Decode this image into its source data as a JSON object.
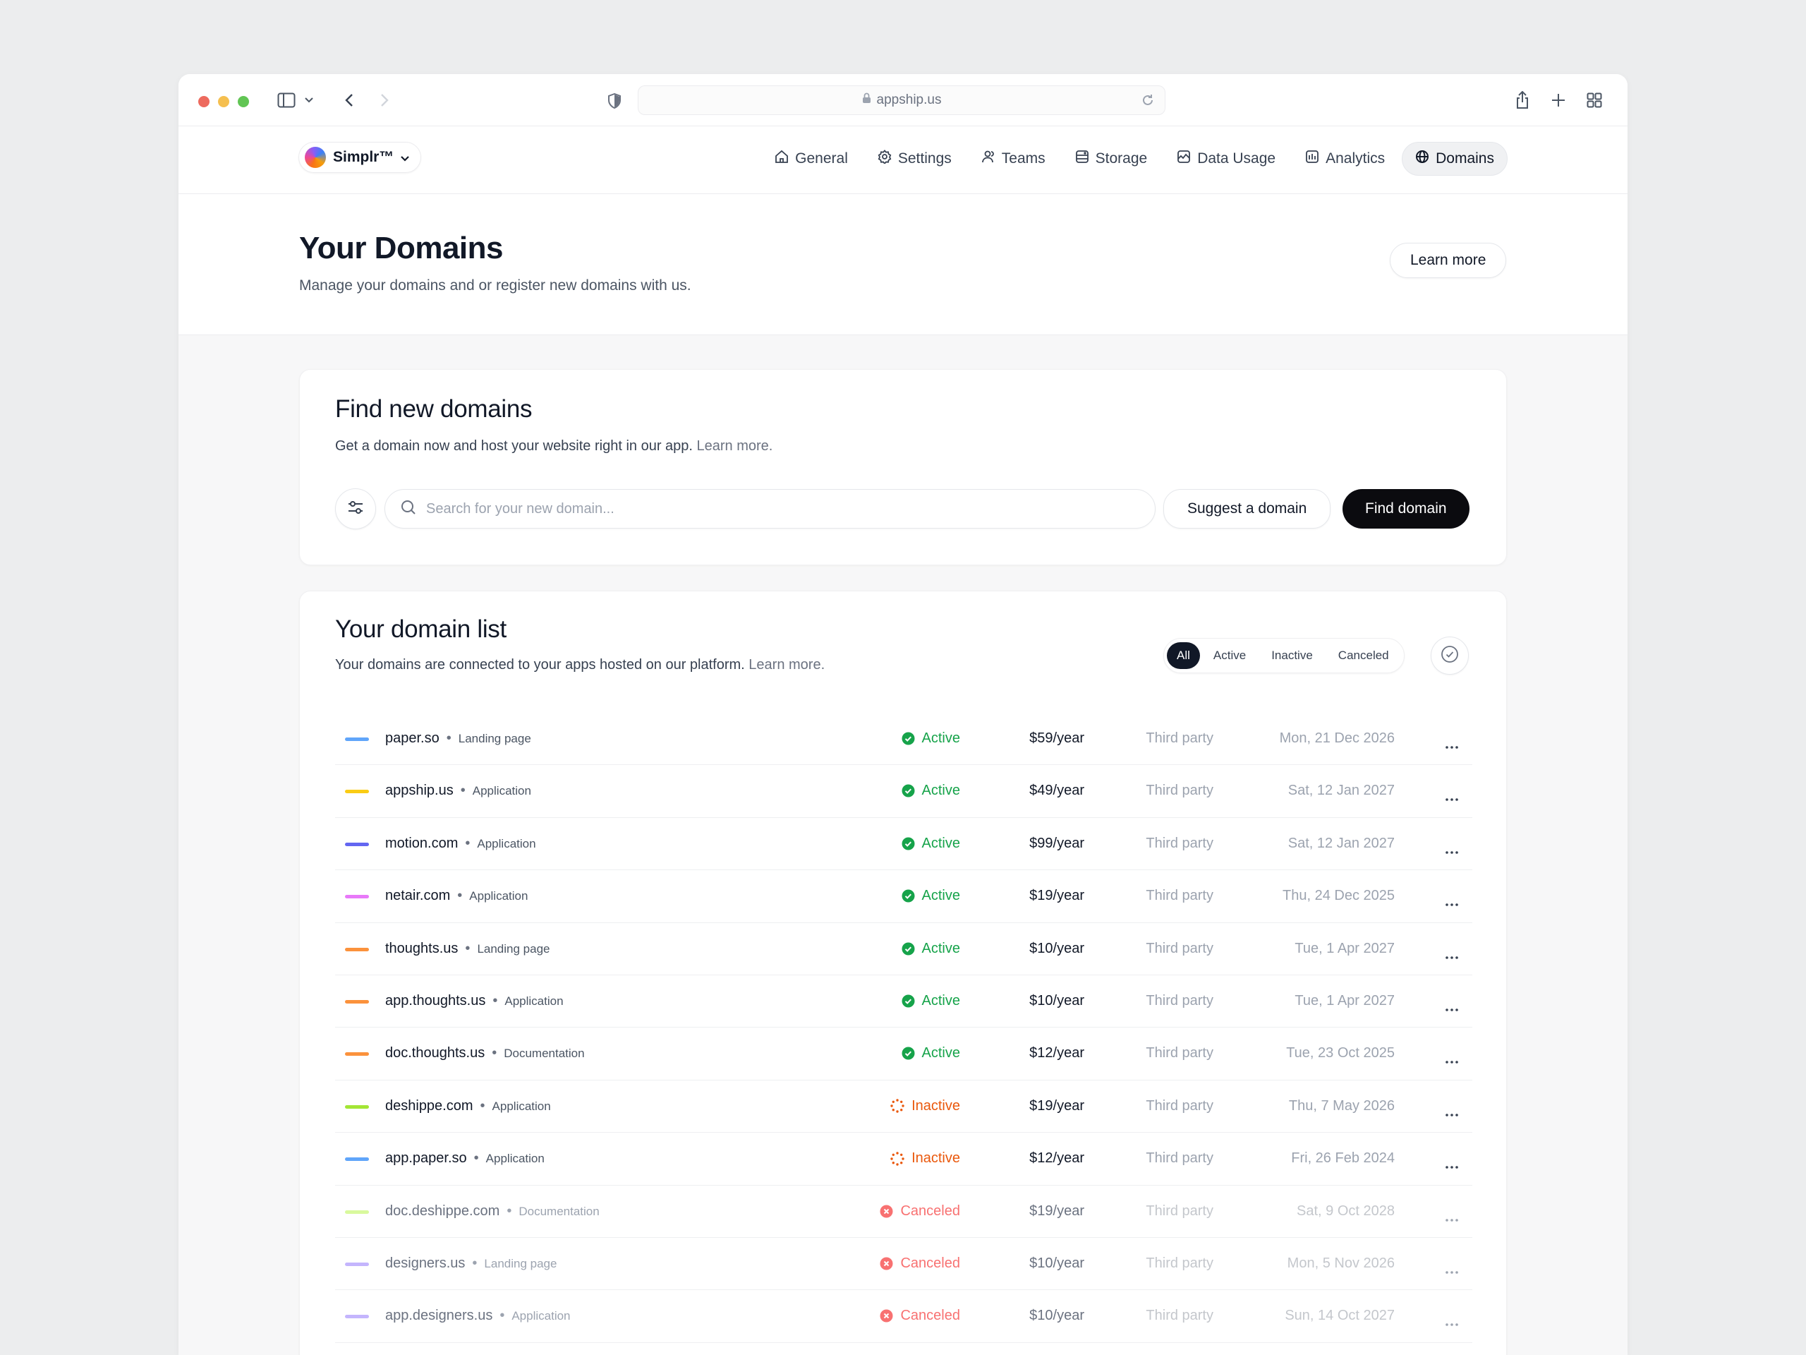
{
  "browser": {
    "url": "appship.us",
    "traffic_lights": [
      "#ed6a5e",
      "#f5bf4f",
      "#61c554"
    ]
  },
  "app": {
    "brand_name": "Simplr™",
    "nav": [
      {
        "label": "General",
        "icon": "home-icon",
        "active": false
      },
      {
        "label": "Settings",
        "icon": "gear-icon",
        "active": false
      },
      {
        "label": "Teams",
        "icon": "users-icon",
        "active": false
      },
      {
        "label": "Storage",
        "icon": "database-icon",
        "active": false
      },
      {
        "label": "Data Usage",
        "icon": "chart-box-icon",
        "active": false
      },
      {
        "label": "Analytics",
        "icon": "bars-icon",
        "active": false
      },
      {
        "label": "Domains",
        "icon": "globe-icon",
        "active": true
      }
    ]
  },
  "hero": {
    "title": "Your Domains",
    "subtitle": "Manage your domains and or register new domains with us.",
    "learn_more": "Learn more"
  },
  "find": {
    "title": "Find new domains",
    "subtitle": "Get a domain now and host your website right in our app.",
    "subtitle_link": "Learn more.",
    "search_placeholder": "Search for your new domain...",
    "suggest_label": "Suggest a domain",
    "find_label": "Find domain"
  },
  "list": {
    "title": "Your domain list",
    "subtitle": "Your domains are connected to your apps hosted on our platform.",
    "subtitle_link": "Learn more.",
    "filters": [
      "All",
      "Active",
      "Inactive",
      "Canceled"
    ],
    "selected_filter": "All",
    "domains": [
      {
        "name": "paper.so",
        "type": "Landing page",
        "status": "Active",
        "price": "$59/year",
        "provider": "Third party",
        "date": "Mon, 21 Dec 2026",
        "color": "#60a5fa"
      },
      {
        "name": "appship.us",
        "type": "Application",
        "status": "Active",
        "price": "$49/year",
        "provider": "Third party",
        "date": "Sat, 12 Jan 2027",
        "color": "#facc15"
      },
      {
        "name": "motion.com",
        "type": "Application",
        "status": "Active",
        "price": "$99/year",
        "provider": "Third party",
        "date": "Sat, 12 Jan 2027",
        "color": "#6366f1"
      },
      {
        "name": "netair.com",
        "type": "Application",
        "status": "Active",
        "price": "$19/year",
        "provider": "Third party",
        "date": "Thu, 24 Dec 2025",
        "color": "#e879f9"
      },
      {
        "name": "thoughts.us",
        "type": "Landing page",
        "status": "Active",
        "price": "$10/year",
        "provider": "Third party",
        "date": "Tue, 1 Apr 2027",
        "color": "#fb923c"
      },
      {
        "name": "app.thoughts.us",
        "type": "Application",
        "status": "Active",
        "price": "$10/year",
        "provider": "Third party",
        "date": "Tue, 1 Apr 2027",
        "color": "#fb923c"
      },
      {
        "name": "doc.thoughts.us",
        "type": "Documentation",
        "status": "Active",
        "price": "$12/year",
        "provider": "Third party",
        "date": "Tue, 23 Oct 2025",
        "color": "#fb923c"
      },
      {
        "name": "deshippe.com",
        "type": "Application",
        "status": "Inactive",
        "price": "$19/year",
        "provider": "Third party",
        "date": "Thu, 7 May 2026",
        "color": "#a3e635"
      },
      {
        "name": "app.paper.so",
        "type": "Application",
        "status": "Inactive",
        "price": "$12/year",
        "provider": "Third party",
        "date": "Fri, 26 Feb 2024",
        "color": "#60a5fa"
      },
      {
        "name": "doc.deshippe.com",
        "type": "Documentation",
        "status": "Canceled",
        "price": "$19/year",
        "provider": "Third party",
        "date": "Sat, 9 Oct 2028",
        "color": "#d9f99d"
      },
      {
        "name": "designers.us",
        "type": "Landing page",
        "status": "Canceled",
        "price": "$10/year",
        "provider": "Third party",
        "date": "Mon, 5 Nov 2026",
        "color": "#c4b5fd"
      },
      {
        "name": "app.designers.us",
        "type": "Application",
        "status": "Canceled",
        "price": "$10/year",
        "provider": "Third party",
        "date": "Sun, 14 Oct 2027",
        "color": "#c4b5fd"
      }
    ]
  }
}
